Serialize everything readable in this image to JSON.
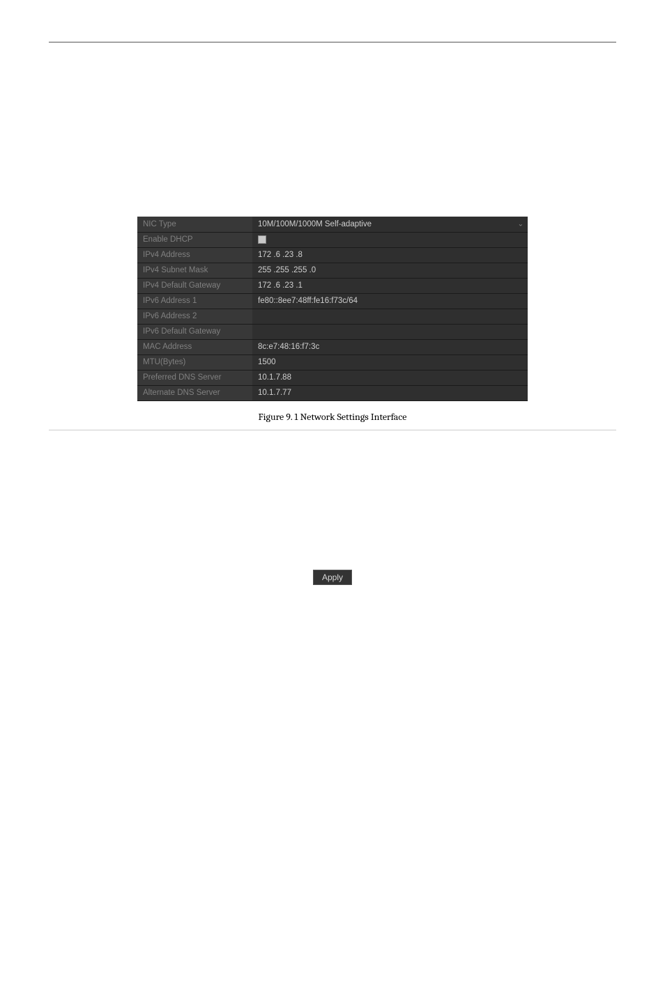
{
  "settings": {
    "rows": [
      {
        "label": "NIC Type",
        "value": "10M/100M/1000M Self-adaptive",
        "type": "dropdown"
      },
      {
        "label": "Enable DHCP",
        "value": "",
        "type": "checkbox"
      },
      {
        "label": "IPv4 Address",
        "value": "172 .6   .23  .8",
        "type": "text"
      },
      {
        "label": "IPv4 Subnet Mask",
        "value": "255 .255 .255 .0",
        "type": "text"
      },
      {
        "label": "IPv4 Default Gateway",
        "value": "172 .6   .23  .1",
        "type": "text"
      },
      {
        "label": "IPv6 Address 1",
        "value": "fe80::8ee7:48ff:fe16:f73c/64",
        "type": "text"
      },
      {
        "label": "IPv6 Address 2",
        "value": "",
        "type": "text"
      },
      {
        "label": "IPv6 Default Gateway",
        "value": "",
        "type": "text"
      },
      {
        "label": "MAC Address",
        "value": "8c:e7:48:16:f7:3c",
        "type": "text"
      },
      {
        "label": "MTU(Bytes)",
        "value": "1500",
        "type": "text"
      },
      {
        "label": "Preferred DNS Server",
        "value": "10.1.7.88",
        "type": "text"
      },
      {
        "label": "Alternate DNS Server",
        "value": "10.1.7.77",
        "type": "text"
      }
    ]
  },
  "caption": "Figure 9. 1  Network Settings Interface",
  "apply_label": "Apply"
}
